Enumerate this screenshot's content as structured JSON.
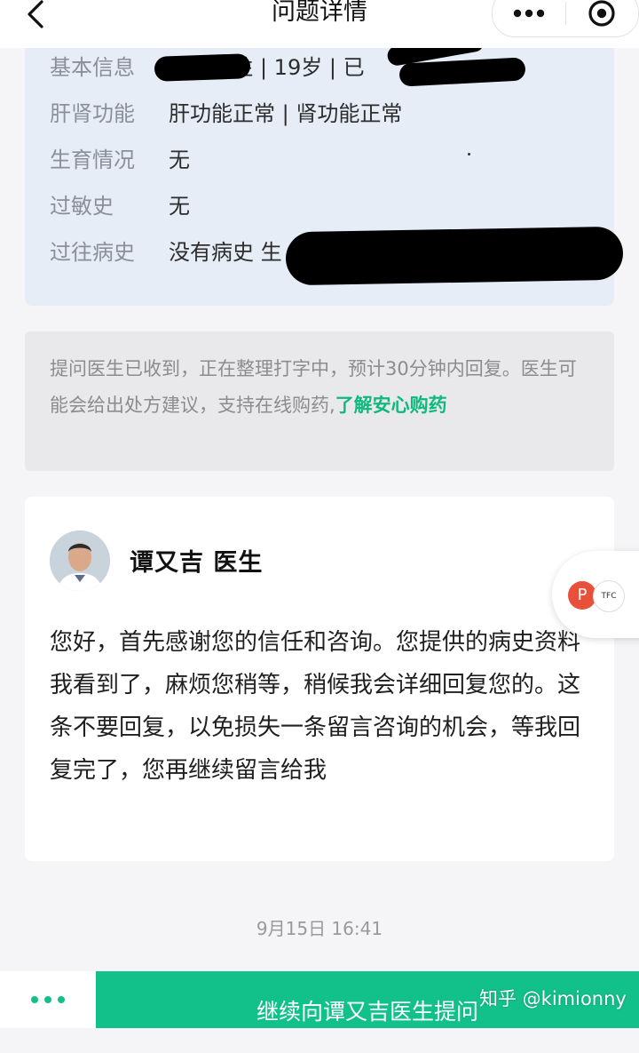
{
  "nav": {
    "title": "问题详情",
    "back_icon": "chevron-left-icon",
    "more_icon": "ellipsis-icon",
    "close_icon": "target-icon"
  },
  "info": {
    "rows": [
      {
        "label": "基本信息",
        "value": "女 | 女性 | 19岁 | 已",
        "redacted": true
      },
      {
        "label": "肝肾功能",
        "value": "肝功能正常 | 肾功能正常"
      },
      {
        "label": "生育情况",
        "value": "无"
      },
      {
        "label": "过敏史",
        "value": "无"
      },
      {
        "label": "过往病史",
        "value": "没有病史 生",
        "redacted": true
      }
    ]
  },
  "notice": {
    "text": "提问医生已收到，正在整理打字中，预计30分钟内回复。医生可能会给出处方建议，支持在线购药,",
    "link": "了解安心购药"
  },
  "doctor": {
    "name": "谭又吉 医生",
    "message": "您好，首先感谢您的信任和咨询。您提供的病史资料我看到了，麻烦您稍等，稍候我会详细回复您的。这条不要回复，以免损失一条留言咨询的机会，等我回复完了，您再继续留言给我"
  },
  "float_widget": {
    "p_label": "P",
    "logo_label": "TFC"
  },
  "timestamp": "9月15日 16:41",
  "bottom": {
    "more_icon": "ellipsis-icon",
    "cta_label": "继续向谭又吉医生提问"
  },
  "watermark": "知乎 @kimionny",
  "colors": {
    "accent": "#12c08a",
    "link": "#0fb97e",
    "info_bg": "#e6edf7"
  }
}
